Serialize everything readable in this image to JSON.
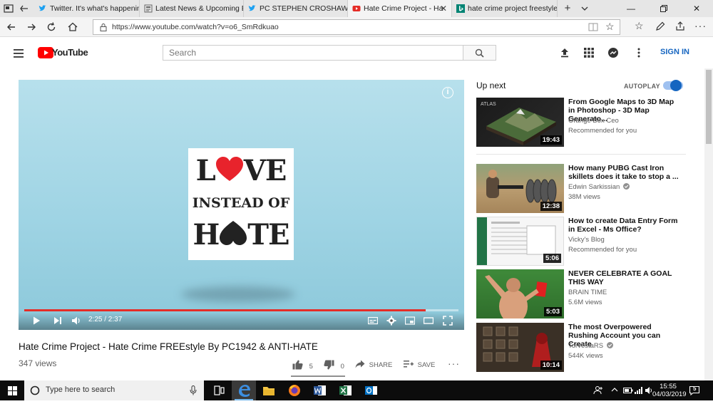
{
  "browser": {
    "tabs": [
      {
        "label": "Twitter. It's what's happenin",
        "icon": "twitter-icon"
      },
      {
        "label": "Latest News & Upcoming E",
        "icon": "news-icon"
      },
      {
        "label": "PC STEPHEN CROSHAW (@",
        "icon": "twitter-icon"
      },
      {
        "label": "Hate Crime Project - Ha",
        "icon": "youtube-icon",
        "active": true
      },
      {
        "label": "hate crime project freestyle",
        "icon": "bing-icon"
      }
    ],
    "url": "https://www.youtube.com/watch?v=o6_SmRdkuao"
  },
  "youtube": {
    "logo_text": "YouTube",
    "search_placeholder": "Search",
    "sign_in": "SIGN IN"
  },
  "video": {
    "overlay_line1_a": "L",
    "overlay_line1_b": "VE",
    "overlay_line2": "INSTEAD OF",
    "overlay_line3_a": "H",
    "overlay_line3_b": "TE",
    "time": "2:25 / 2:37",
    "progress_fraction": 0.924,
    "title": "Hate Crime Project - Hate Crime FREEstyle By PC1942 & ANTI-HATE",
    "views": "347 views",
    "likes": "5",
    "dislikes": "0",
    "share": "SHARE",
    "save": "SAVE"
  },
  "sidebar": {
    "up_next": "Up next",
    "autoplay": "AUTOPLAY",
    "items": [
      {
        "title": "From Google Maps to 3D Map in Photoshop - 3D Map Generato...",
        "channel": "Orange Box Ceo",
        "meta": "Recommended for you",
        "duration": "19:43",
        "verified": false
      },
      {
        "title": "How many PUBG Cast Iron skillets does it take to stop a ...",
        "channel": "Edwin Sarkissian",
        "meta": "38M views",
        "duration": "12:38",
        "verified": true
      },
      {
        "title": "How to create Data Entry Form in Excel - Ms Office?",
        "channel": "Vicky's Blog",
        "meta": "Recommended for you",
        "duration": "5:06",
        "verified": false
      },
      {
        "title": "NEVER CELEBRATE A GOAL THIS WAY",
        "channel": "BRAIN TIME",
        "meta": "5.6M views",
        "duration": "5:03",
        "verified": false
      },
      {
        "title": "The most Overpowered Rushing Account you can Create",
        "channel": "TorvestaRS",
        "meta": "544K views",
        "duration": "10:14",
        "verified": true
      }
    ]
  },
  "taskbar": {
    "search_text": "Type here to search",
    "time": "15:55",
    "date": "04/03/2019",
    "notifications": "5"
  }
}
